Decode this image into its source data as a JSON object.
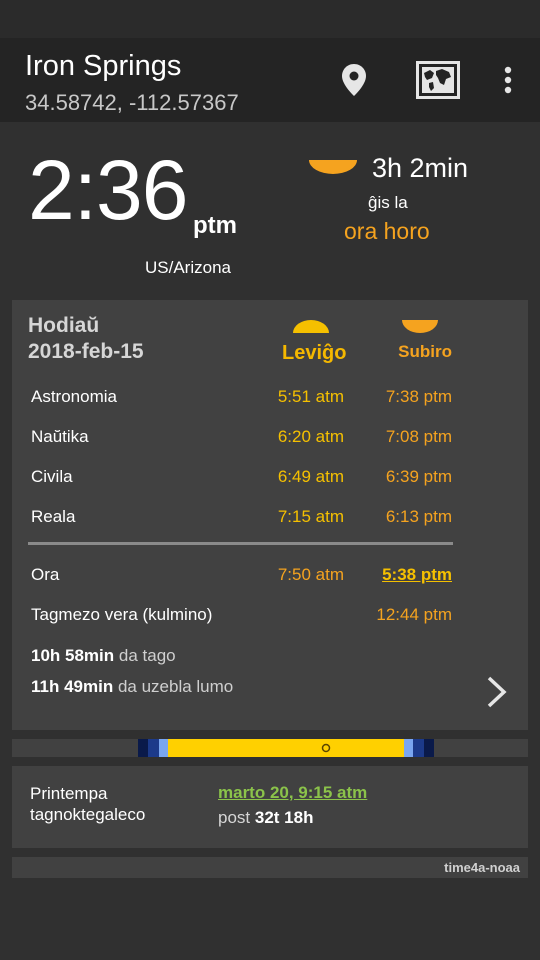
{
  "location": {
    "name": "Iron Springs",
    "coords": "34.58742, -112.57367"
  },
  "toolbar": {
    "icons": [
      "location-pin-icon",
      "map-icon",
      "overflow-menu-icon"
    ]
  },
  "clock": {
    "time": "2:36",
    "ampm": "ptm",
    "timezone": "US/Arizona"
  },
  "countdown": {
    "remaining": "3h 2min",
    "until_label": "ĝis la",
    "event": "ora horo"
  },
  "today": {
    "label": "Hodiaŭ",
    "date": "2018-feb-15",
    "rise_header": "Leviĝo",
    "set_header": "Subiro",
    "twilight_rows": [
      {
        "label": "Astronomia",
        "rise": "5:51 atm",
        "set": "7:38 ptm"
      },
      {
        "label": "Naŭtika",
        "rise": "6:20 atm",
        "set": "7:08 ptm"
      },
      {
        "label": "Civila",
        "rise": "6:49 atm",
        "set": "6:39 ptm"
      },
      {
        "label": "Reala",
        "rise": "7:15 atm",
        "set": "6:13 ptm"
      }
    ],
    "golden_row": {
      "label": "Ora",
      "rise": "7:50 atm",
      "set": "5:38 ptm"
    },
    "noon": {
      "label": "Tagmezo vera (kulmino)",
      "value": "12:44 ptm"
    },
    "day_length": {
      "value": "10h 58min",
      "suffix": "da tago"
    },
    "light_length": {
      "value": "11h 49min",
      "suffix": "da uzebla lumo"
    }
  },
  "season": {
    "label_line1": "Printempa",
    "label_line2": "tagnoktegaleco",
    "date": "marto 20, 9:15 atm",
    "after_prefix": "post",
    "after_value": "32t 18h"
  },
  "credit": "time4a-noaa",
  "colors": {
    "accent_yellow": "#f5c000",
    "accent_orange": "#f5a31f",
    "link_green": "#8bc34a",
    "card_bg": "#414141"
  }
}
